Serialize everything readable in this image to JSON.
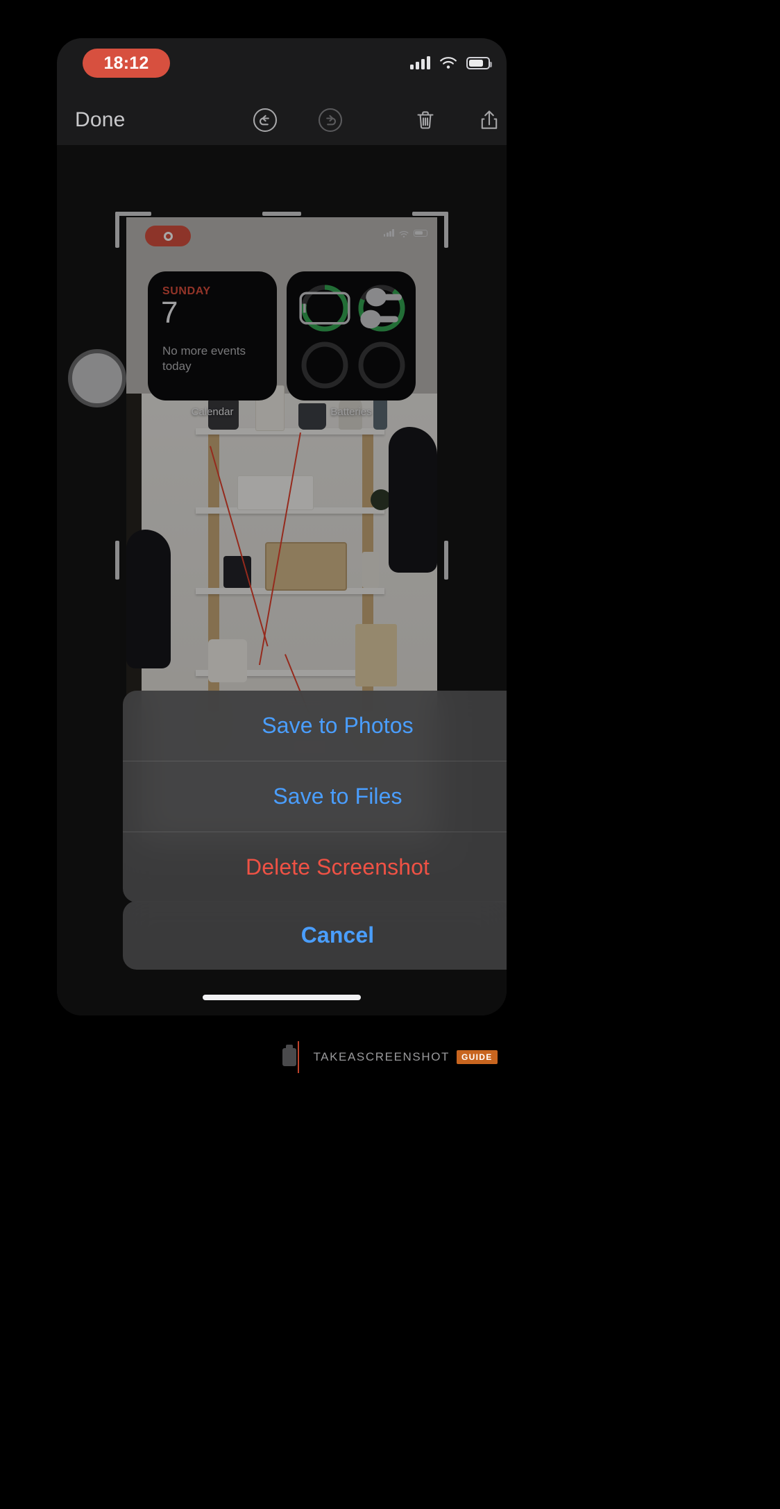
{
  "status_bar": {
    "time": "18:12",
    "time_pill_color": "#d7503f",
    "icons": [
      "cellular-signal-icon",
      "wifi-icon",
      "battery-icon"
    ],
    "battery_level_percent": 66
  },
  "toolbar": {
    "done_label": "Done",
    "icons": [
      "undo-icon",
      "redo-icon",
      "trash-icon",
      "share-icon"
    ],
    "undo_enabled": true,
    "redo_enabled": false,
    "text_color": "#c9c9cb"
  },
  "preview": {
    "status_bar": {
      "recording_indicator": "screen-record-icon",
      "icons": [
        "cellular-signal-icon",
        "wifi-icon",
        "battery-icon"
      ]
    },
    "widgets": [
      {
        "name": "calendar",
        "label": "Calendar",
        "weekday": "SUNDAY",
        "weekday_color": "#e0503e",
        "date": "7",
        "note": "No more events today"
      },
      {
        "name": "batteries",
        "label": "Batteries",
        "ring_color": "#34a853",
        "rings": [
          {
            "device": "iphone-icon",
            "level_percent": 78,
            "active": true
          },
          {
            "device": "airpods-icon",
            "level_percent": 72,
            "active": true
          },
          {
            "device": "empty-slot",
            "level_percent": 0,
            "active": false
          },
          {
            "device": "empty-slot",
            "level_percent": 0,
            "active": false
          }
        ]
      }
    ]
  },
  "action_sheet": {
    "options": [
      {
        "label": "Save to Photos",
        "style": "default",
        "color": "#4a9eff"
      },
      {
        "label": "Save to Files",
        "style": "default",
        "color": "#4a9eff"
      },
      {
        "label": "Delete Screenshot",
        "style": "destructive",
        "color": "#ef5245"
      }
    ],
    "cancel": {
      "label": "Cancel",
      "color": "#4a9eff"
    }
  },
  "watermark": {
    "text": "TAKEASCREENSHOT",
    "badge": "GUIDE",
    "accent_color": "#c8651f"
  }
}
